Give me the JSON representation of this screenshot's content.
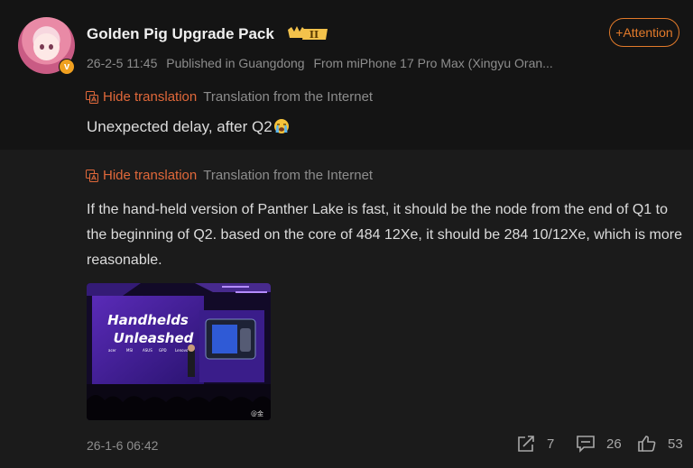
{
  "post": {
    "author": "Golden Pig Upgrade Pack",
    "vip_level": "II",
    "verified_mark": "v",
    "timestamp": "26-2-5 11:45",
    "location": "Published in Guangdong",
    "device": "From miPhone 17 Pro Max (Xingyu Oran...",
    "follow_label": "+Attention",
    "translation": {
      "hide_label": "Hide translation",
      "source_label": "Translation from the Internet"
    },
    "text": "Unexpected delay, after Q2"
  },
  "repost": {
    "translation": {
      "hide_label": "Hide translation",
      "source_label": "Translation from the Internet"
    },
    "text": "If the hand-held version of Panther Lake is fast, it should be the node from the end of Q1 to the beginning of Q2. based on the core of 484 12Xe, it should be 284 10/12Xe, which is more reasonable.",
    "image": {
      "headline_line1": "Handhelds",
      "headline_line2": "Unleashed",
      "logos": [
        "acer",
        "MSI",
        "ASUS",
        "GPD",
        "Lenovo"
      ],
      "watermark": "@金"
    },
    "timestamp": "26-1-6 06:42",
    "share_count": "7",
    "comment_count": "26",
    "like_count": "53"
  },
  "colors": {
    "accent": "#e0683a",
    "follow": "#e27a2a",
    "muted": "#8d8d8d"
  }
}
